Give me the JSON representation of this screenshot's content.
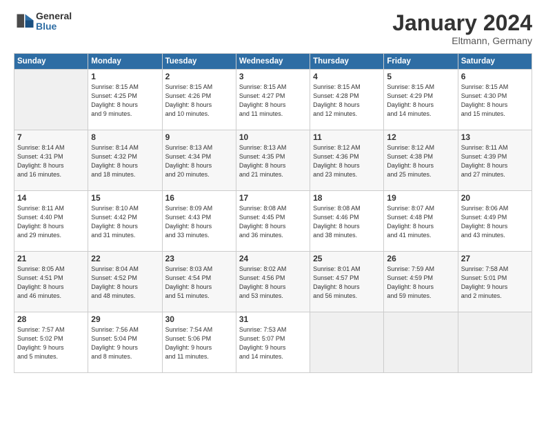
{
  "header": {
    "logo_general": "General",
    "logo_blue": "Blue",
    "month_title": "January 2024",
    "location": "Eltmann, Germany"
  },
  "weekdays": [
    "Sunday",
    "Monday",
    "Tuesday",
    "Wednesday",
    "Thursday",
    "Friday",
    "Saturday"
  ],
  "weeks": [
    [
      {
        "day": "",
        "info": ""
      },
      {
        "day": "1",
        "info": "Sunrise: 8:15 AM\nSunset: 4:25 PM\nDaylight: 8 hours\nand 9 minutes."
      },
      {
        "day": "2",
        "info": "Sunrise: 8:15 AM\nSunset: 4:26 PM\nDaylight: 8 hours\nand 10 minutes."
      },
      {
        "day": "3",
        "info": "Sunrise: 8:15 AM\nSunset: 4:27 PM\nDaylight: 8 hours\nand 11 minutes."
      },
      {
        "day": "4",
        "info": "Sunrise: 8:15 AM\nSunset: 4:28 PM\nDaylight: 8 hours\nand 12 minutes."
      },
      {
        "day": "5",
        "info": "Sunrise: 8:15 AM\nSunset: 4:29 PM\nDaylight: 8 hours\nand 14 minutes."
      },
      {
        "day": "6",
        "info": "Sunrise: 8:15 AM\nSunset: 4:30 PM\nDaylight: 8 hours\nand 15 minutes."
      }
    ],
    [
      {
        "day": "7",
        "info": "Sunrise: 8:14 AM\nSunset: 4:31 PM\nDaylight: 8 hours\nand 16 minutes."
      },
      {
        "day": "8",
        "info": "Sunrise: 8:14 AM\nSunset: 4:32 PM\nDaylight: 8 hours\nand 18 minutes."
      },
      {
        "day": "9",
        "info": "Sunrise: 8:13 AM\nSunset: 4:34 PM\nDaylight: 8 hours\nand 20 minutes."
      },
      {
        "day": "10",
        "info": "Sunrise: 8:13 AM\nSunset: 4:35 PM\nDaylight: 8 hours\nand 21 minutes."
      },
      {
        "day": "11",
        "info": "Sunrise: 8:12 AM\nSunset: 4:36 PM\nDaylight: 8 hours\nand 23 minutes."
      },
      {
        "day": "12",
        "info": "Sunrise: 8:12 AM\nSunset: 4:38 PM\nDaylight: 8 hours\nand 25 minutes."
      },
      {
        "day": "13",
        "info": "Sunrise: 8:11 AM\nSunset: 4:39 PM\nDaylight: 8 hours\nand 27 minutes."
      }
    ],
    [
      {
        "day": "14",
        "info": "Sunrise: 8:11 AM\nSunset: 4:40 PM\nDaylight: 8 hours\nand 29 minutes."
      },
      {
        "day": "15",
        "info": "Sunrise: 8:10 AM\nSunset: 4:42 PM\nDaylight: 8 hours\nand 31 minutes."
      },
      {
        "day": "16",
        "info": "Sunrise: 8:09 AM\nSunset: 4:43 PM\nDaylight: 8 hours\nand 33 minutes."
      },
      {
        "day": "17",
        "info": "Sunrise: 8:08 AM\nSunset: 4:45 PM\nDaylight: 8 hours\nand 36 minutes."
      },
      {
        "day": "18",
        "info": "Sunrise: 8:08 AM\nSunset: 4:46 PM\nDaylight: 8 hours\nand 38 minutes."
      },
      {
        "day": "19",
        "info": "Sunrise: 8:07 AM\nSunset: 4:48 PM\nDaylight: 8 hours\nand 41 minutes."
      },
      {
        "day": "20",
        "info": "Sunrise: 8:06 AM\nSunset: 4:49 PM\nDaylight: 8 hours\nand 43 minutes."
      }
    ],
    [
      {
        "day": "21",
        "info": "Sunrise: 8:05 AM\nSunset: 4:51 PM\nDaylight: 8 hours\nand 46 minutes."
      },
      {
        "day": "22",
        "info": "Sunrise: 8:04 AM\nSunset: 4:52 PM\nDaylight: 8 hours\nand 48 minutes."
      },
      {
        "day": "23",
        "info": "Sunrise: 8:03 AM\nSunset: 4:54 PM\nDaylight: 8 hours\nand 51 minutes."
      },
      {
        "day": "24",
        "info": "Sunrise: 8:02 AM\nSunset: 4:56 PM\nDaylight: 8 hours\nand 53 minutes."
      },
      {
        "day": "25",
        "info": "Sunrise: 8:01 AM\nSunset: 4:57 PM\nDaylight: 8 hours\nand 56 minutes."
      },
      {
        "day": "26",
        "info": "Sunrise: 7:59 AM\nSunset: 4:59 PM\nDaylight: 8 hours\nand 59 minutes."
      },
      {
        "day": "27",
        "info": "Sunrise: 7:58 AM\nSunset: 5:01 PM\nDaylight: 9 hours\nand 2 minutes."
      }
    ],
    [
      {
        "day": "28",
        "info": "Sunrise: 7:57 AM\nSunset: 5:02 PM\nDaylight: 9 hours\nand 5 minutes."
      },
      {
        "day": "29",
        "info": "Sunrise: 7:56 AM\nSunset: 5:04 PM\nDaylight: 9 hours\nand 8 minutes."
      },
      {
        "day": "30",
        "info": "Sunrise: 7:54 AM\nSunset: 5:06 PM\nDaylight: 9 hours\nand 11 minutes."
      },
      {
        "day": "31",
        "info": "Sunrise: 7:53 AM\nSunset: 5:07 PM\nDaylight: 9 hours\nand 14 minutes."
      },
      {
        "day": "",
        "info": ""
      },
      {
        "day": "",
        "info": ""
      },
      {
        "day": "",
        "info": ""
      }
    ]
  ]
}
